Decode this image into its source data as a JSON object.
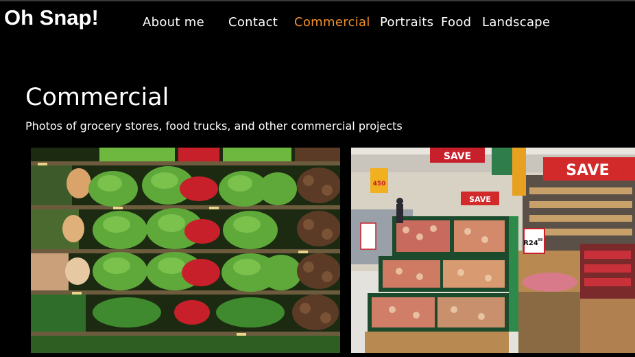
{
  "site": {
    "logo": "Oh Snap!"
  },
  "nav": {
    "items": [
      {
        "label": "About me",
        "active": false
      },
      {
        "label": "Contact",
        "active": false
      },
      {
        "label": "Commercial",
        "active": true
      },
      {
        "label": "Portraits",
        "active": false
      },
      {
        "label": "Food",
        "active": false
      },
      {
        "label": "Landscape",
        "active": false
      }
    ],
    "active_color": "#f0902c"
  },
  "page": {
    "title": "Commercial",
    "subtitle": "Photos of grocery stores, food trucks, and other commercial projects"
  },
  "gallery": {
    "photos": [
      {
        "subject": "produce shelves with lettuce, radishes and potatoes"
      },
      {
        "subject": "supermarket fruit display with SAVE signs"
      }
    ],
    "signs": {
      "save": "SAVE",
      "price_tag": "R24",
      "price_cents": "99",
      "small_price": "450"
    }
  }
}
